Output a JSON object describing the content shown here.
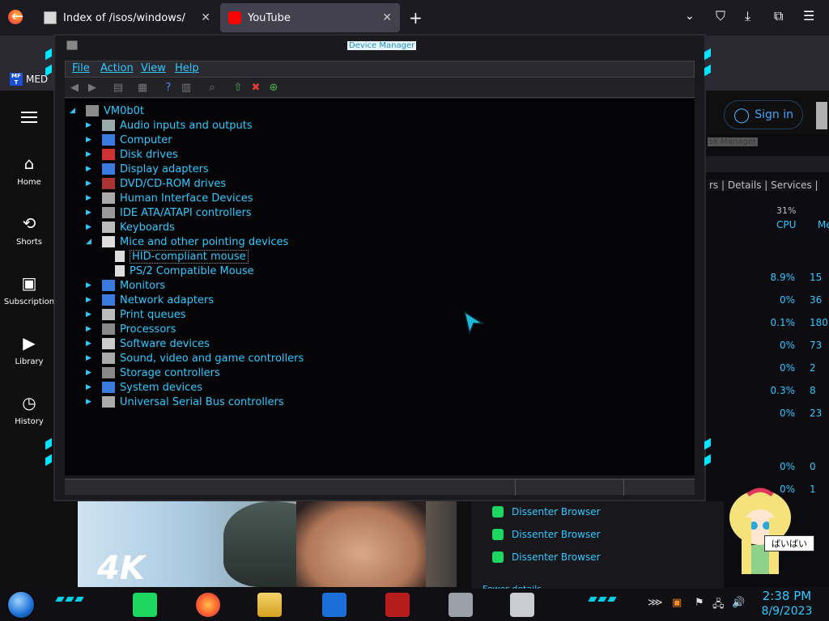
{
  "browser": {
    "tabs": [
      {
        "title": "Index of /isos/windows/",
        "icon": "file-icon"
      },
      {
        "title": "YouTube",
        "icon": "youtube-icon",
        "active": true
      }
    ],
    "new_tab": "+",
    "bookmark_label": "MED",
    "bookmark_icon_text": "MF T"
  },
  "youtube": {
    "sidebar": [
      {
        "label": "Home",
        "icon": "home-icon"
      },
      {
        "label": "Shorts",
        "icon": "shorts-icon"
      },
      {
        "label": "Subscription",
        "icon": "subscriptions-icon"
      },
      {
        "label": "Library",
        "icon": "library-icon"
      },
      {
        "label": "History",
        "icon": "history-icon"
      }
    ],
    "sign_in": "Sign in",
    "video_badge": "4K",
    "dissenter": [
      "Dissenter Browser",
      "Dissenter Browser",
      "Dissenter Browser"
    ],
    "fewer_details": "Fewer details"
  },
  "task_manager": {
    "title": "sk Manager",
    "tabs": "rs | Details | Services |",
    "cpu_percent": "31%",
    "cpu_label": "CPU",
    "mem_label": "Me",
    "cpu_values": [
      "8.9%",
      "0%",
      "0.1%",
      "0%",
      "0%",
      "0.3%",
      "0%",
      "0%",
      "0%"
    ],
    "mem_values": [
      "15",
      "36",
      "180",
      "73",
      "2",
      "8",
      "23",
      "0",
      "1"
    ]
  },
  "device_manager": {
    "title": "Device Manager",
    "menu": [
      "File",
      "Action",
      "View",
      "Help"
    ],
    "root": "VM0b0t",
    "nodes": [
      {
        "label": "Audio inputs and outputs",
        "icon": "speaker-icon"
      },
      {
        "label": "Computer",
        "icon": "computer-icon"
      },
      {
        "label": "Disk drives",
        "icon": "disk-icon"
      },
      {
        "label": "Display adapters",
        "icon": "display-adapter-icon"
      },
      {
        "label": "DVD/CD-ROM drives",
        "icon": "dvd-icon"
      },
      {
        "label": "Human Interface Devices",
        "icon": "hid-icon"
      },
      {
        "label": "IDE ATA/ATAPI controllers",
        "icon": "ide-icon"
      },
      {
        "label": "Keyboards",
        "icon": "keyboard-icon"
      },
      {
        "label": "Mice and other pointing devices",
        "icon": "mouse-icon",
        "expanded": true,
        "children": [
          {
            "label": "HID-compliant mouse",
            "selected": true
          },
          {
            "label": "PS/2 Compatible Mouse"
          }
        ]
      },
      {
        "label": "Monitors",
        "icon": "monitor-icon"
      },
      {
        "label": "Network adapters",
        "icon": "network-icon"
      },
      {
        "label": "Print queues",
        "icon": "printer-icon"
      },
      {
        "label": "Processors",
        "icon": "cpu-icon"
      },
      {
        "label": "Software devices",
        "icon": "software-icon"
      },
      {
        "label": "Sound, video and game controllers",
        "icon": "sound-icon"
      },
      {
        "label": "Storage controllers",
        "icon": "storage-icon"
      },
      {
        "label": "System devices",
        "icon": "system-icon"
      },
      {
        "label": "Universal Serial Bus controllers",
        "icon": "usb-icon"
      }
    ]
  },
  "desktop": {
    "character_speech": "ばいばい"
  },
  "taskbar": {
    "time": "2:38 PM",
    "date": "8/9/2023",
    "apps": [
      "dissenter-icon",
      "firefox-icon",
      "explorer-icon",
      "remote-icon",
      "flash-icon",
      "task-manager-icon",
      "device-manager-icon"
    ]
  },
  "colors": {
    "accent": "#2fc9ff",
    "neon": "#00e5ff",
    "window_bg": "#050507"
  }
}
